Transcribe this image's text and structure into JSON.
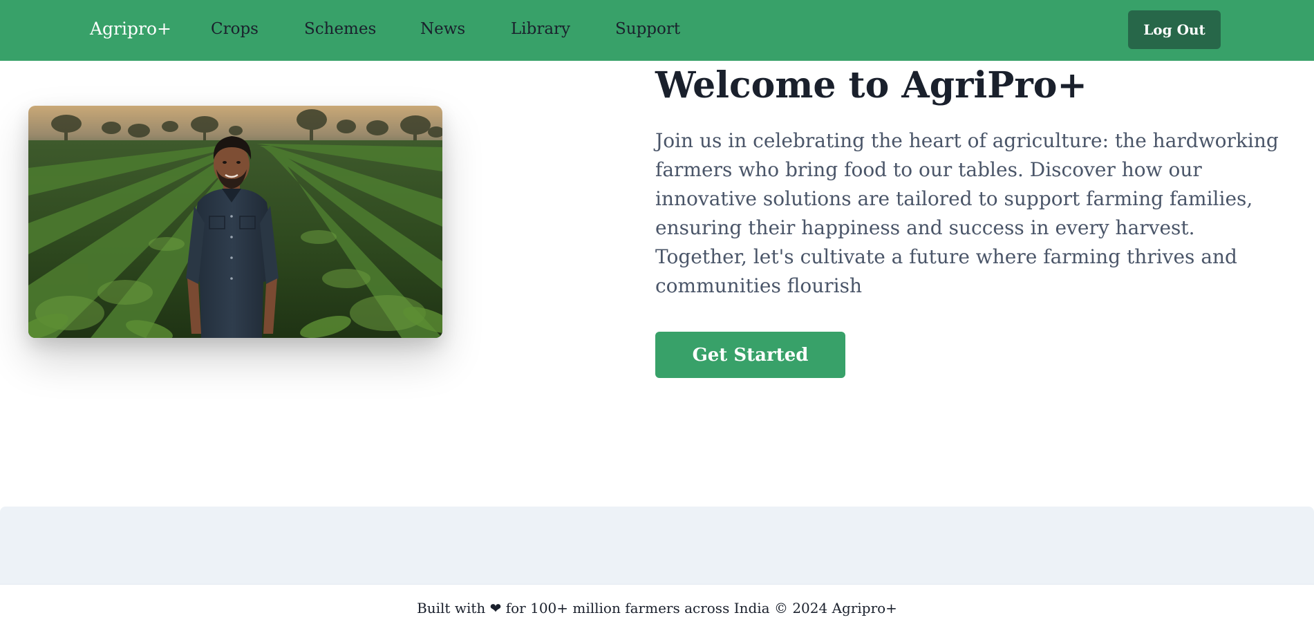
{
  "navbar": {
    "brand": "Agripro+",
    "links": [
      "Crops",
      "Schemes",
      "News",
      "Library",
      "Support"
    ],
    "logout_label": "Log Out",
    "bg_color": "#38a169",
    "logout_color": "#276749"
  },
  "hero": {
    "title": "Welcome to AgriPro+",
    "description": "Join us in celebrating the heart of agriculture: the hardworking farmers who bring food to our tables. Discover how our innovative solutions are tailored to support farming families, ensuring their happiness and success in every harvest. Together, let's cultivate a future where farming thrives and communities flourish",
    "cta_label": "Get Started",
    "image_subject": "farmer-in-crop-field"
  },
  "footer": {
    "text": "Built with ❤ for 100+ million farmers across India © 2024 Agripro+"
  }
}
